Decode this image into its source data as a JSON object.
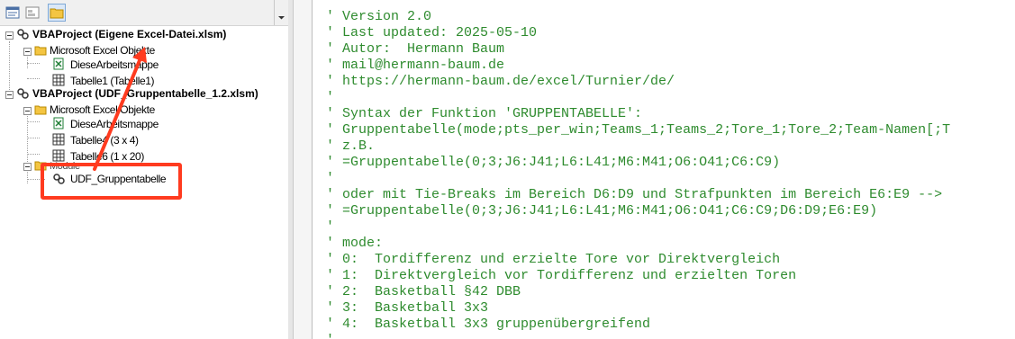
{
  "project_explorer": {
    "toolbar": {
      "buttons": [
        "view-code-icon",
        "view-object-icon",
        "toggle-folders-icon"
      ]
    },
    "tree": {
      "project1": {
        "label": "VBAProject (Eigene Excel-Datei.xlsm)",
        "folder_excel_objects": "Microsoft Excel Objekte",
        "items": [
          "DieseArbeitsmappe",
          "Tabelle1 (Tabelle1)"
        ]
      },
      "project2": {
        "label": "VBAProject (UDF_Gruppentabelle_1.2.xlsm)",
        "folder_excel_objects": "Microsoft Excel Objekte",
        "items": [
          "DieseArbeitsmappe",
          "Tabelle4 (3 x 4)",
          "Tabelle6 (1 x 20)"
        ],
        "folder_modules": "Module",
        "module": "UDF_Gruppentabelle"
      }
    },
    "annotation_color": "#ff3b1f"
  },
  "code_window": {
    "comment_color": "#2e8b2e",
    "lines": [
      "' Version 2.0",
      "' Last updated: 2025-05-10",
      "' Autor:  Hermann Baum",
      "' mail@hermann-baum.de",
      "' https://hermann-baum.de/excel/Turnier/de/",
      "'",
      "' Syntax der Funktion 'GRUPPENTABELLE':",
      "' Gruppentabelle(mode;pts_per_win;Teams_1;Teams_2;Tore_1;Tore_2;Team-Namen[;T",
      "' z.B.",
      "' =Gruppentabelle(0;3;J6:J41;L6:L41;M6:M41;O6:O41;C6:C9)",
      "'",
      "' oder mit Tie-Breaks im Bereich D6:D9 und Strafpunkten im Bereich E6:E9 -->",
      "' =Gruppentabelle(0;3;J6:J41;L6:L41;M6:M41;O6:O41;C6:C9;D6:D9;E6:E9)",
      "'",
      "' mode:",
      "' 0:  Tordifferenz und erzielte Tore vor Direktvergleich",
      "' 1:  Direktvergleich vor Tordifferenz und erzielten Toren",
      "' 2:  Basketball §42 DBB",
      "' 3:  Basketball 3x3",
      "' 4:  Basketball 3x3 gruppenübergreifend",
      "'"
    ]
  }
}
